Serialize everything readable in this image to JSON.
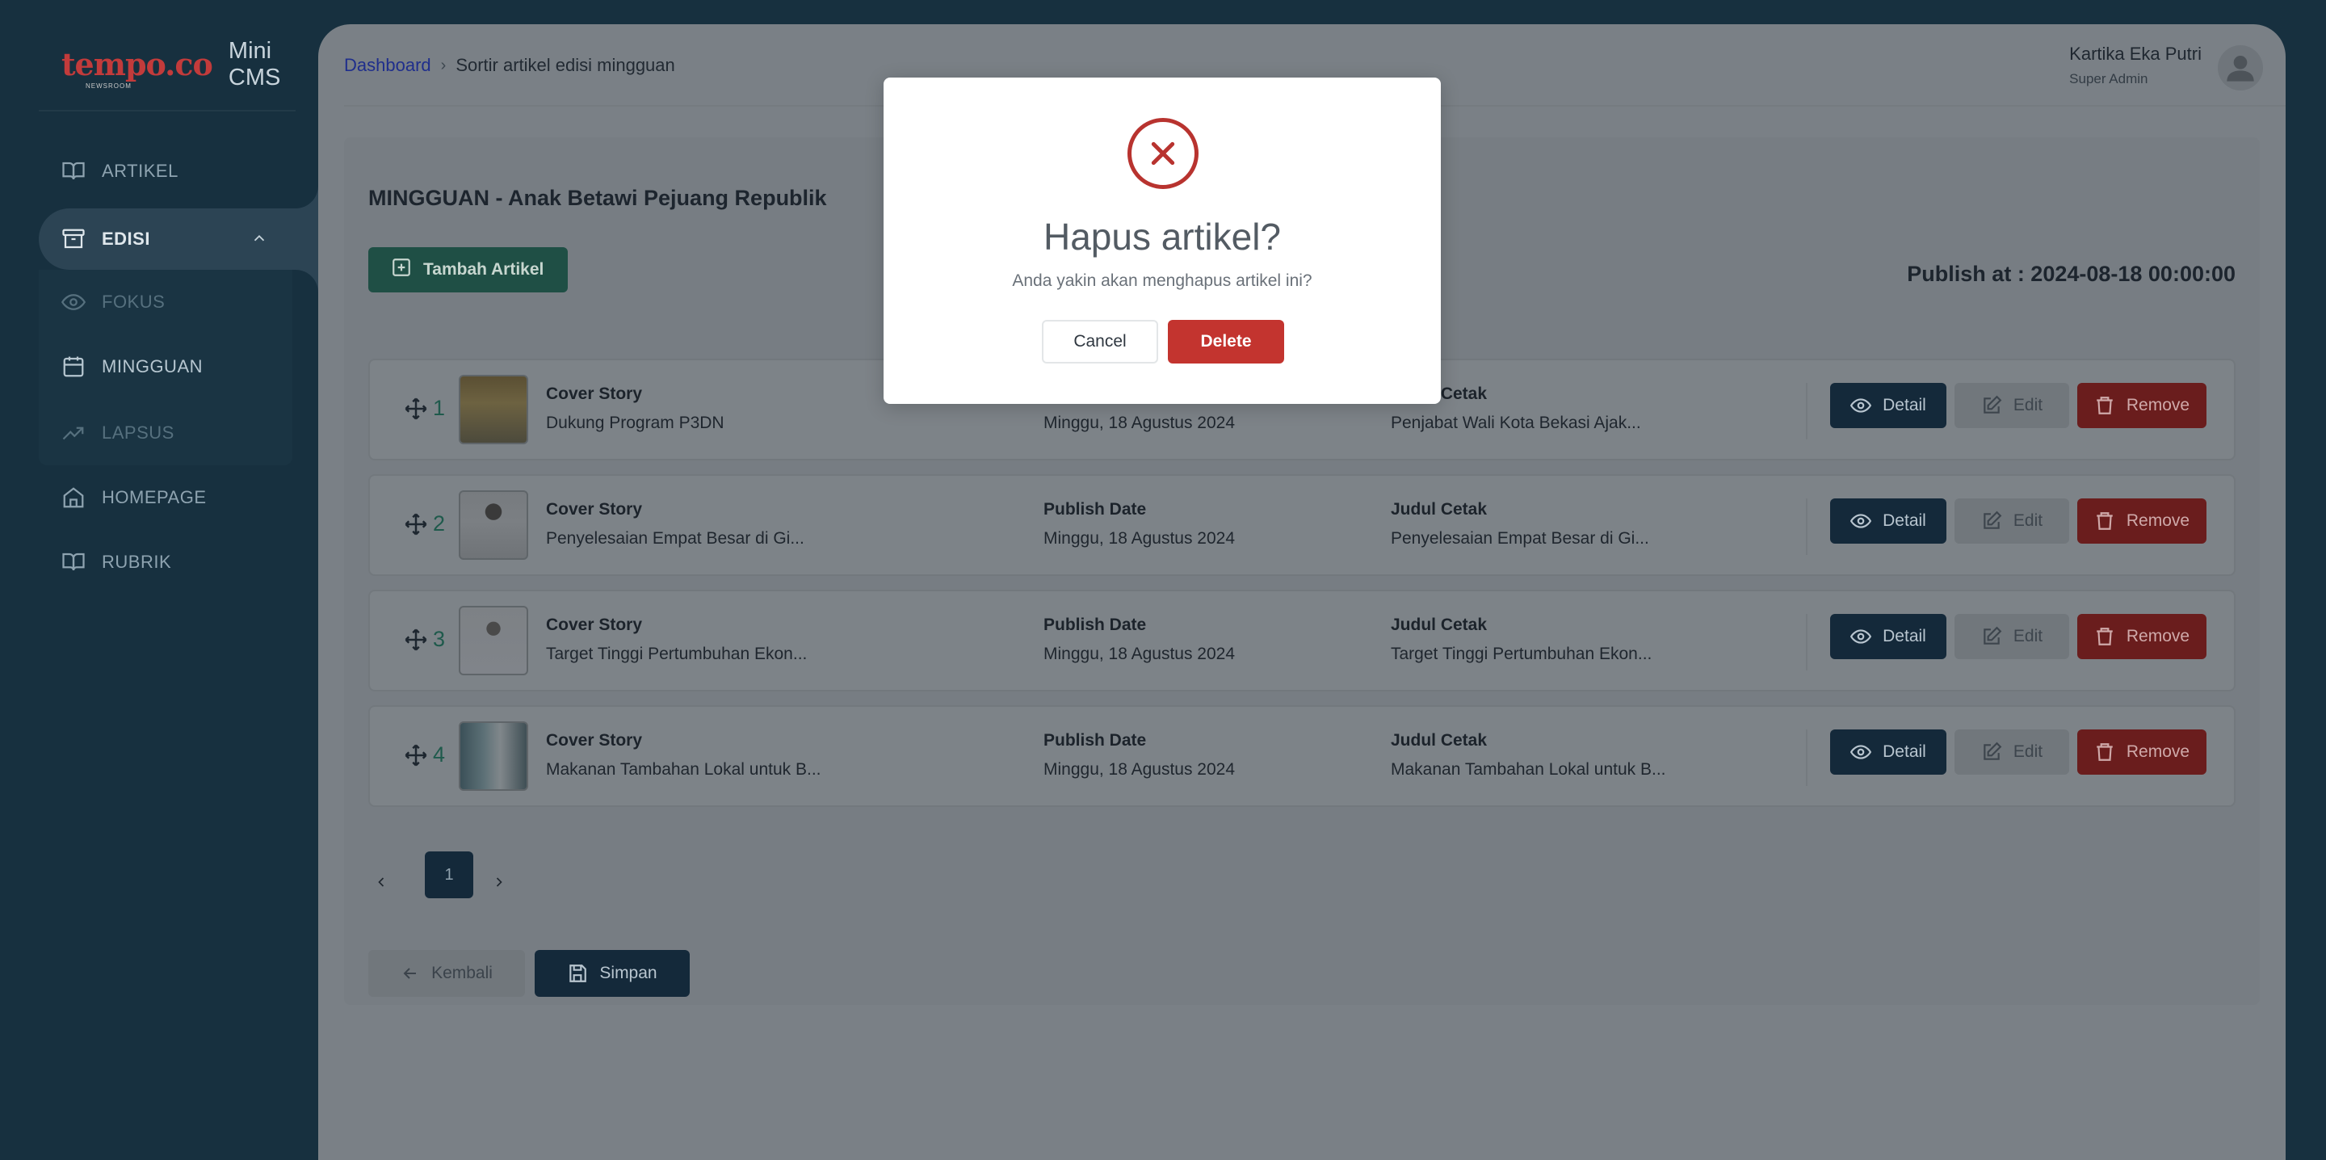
{
  "sidebar": {
    "logo_text": "tempo.co",
    "logo_sub": "NEWSROOM",
    "app_title": "Mini CMS",
    "items": [
      {
        "label": "ARTIKEL",
        "icon": "book-open-icon"
      },
      {
        "label": "EDISI",
        "icon": "archive-icon"
      },
      {
        "label": "FOKUS",
        "icon": "eye-icon"
      },
      {
        "label": "MINGGUAN",
        "icon": "calendar-icon"
      },
      {
        "label": "LAPSUS",
        "icon": "trending-up-icon"
      },
      {
        "label": "HOMEPAGE",
        "icon": "home-icon"
      },
      {
        "label": "RUBRIK",
        "icon": "book-open-icon"
      }
    ]
  },
  "header": {
    "breadcrumb_home": "Dashboard",
    "breadcrumb_current": "Sortir artikel edisi mingguan",
    "user_name": "Kartika Eka Putri",
    "user_role": "Super Admin"
  },
  "edition": {
    "title": "MINGGUAN - Anak Betawi Pejuang Republik",
    "add_button": "Tambah Artikel",
    "publish_at": "Publish at : 2024-08-18 00:00:00"
  },
  "columns": {
    "category_label": "Cover Story",
    "publish_label": "Publish Date",
    "print_label": "Judul Cetak"
  },
  "articles": [
    {
      "no": "1",
      "category": "Cover Story",
      "title": "Dukung Program P3DN",
      "publish_date": "Minggu, 18 Agustus 2024",
      "print_title": "Penjabat Wali Kota Bekasi Ajak..."
    },
    {
      "no": "2",
      "category": "Cover Story",
      "title": "Penyelesaian Empat Besar di Gi...",
      "publish_date": "Minggu, 18 Agustus 2024",
      "print_title": "Penyelesaian Empat Besar di Gi..."
    },
    {
      "no": "3",
      "category": "Cover Story",
      "title": "Target Tinggi Pertumbuhan Ekon...",
      "publish_date": "Minggu, 18 Agustus 2024",
      "print_title": "Target Tinggi Pertumbuhan Ekon..."
    },
    {
      "no": "4",
      "category": "Cover Story",
      "title": "Makanan Tambahan Lokal untuk B...",
      "publish_date": "Minggu, 18 Agustus 2024",
      "print_title": "Makanan Tambahan Lokal untuk B..."
    }
  ],
  "actions": {
    "detail": "Detail",
    "edit": "Edit",
    "remove": "Remove"
  },
  "pagination": {
    "current": "1"
  },
  "footer": {
    "back": "Kembali",
    "save": "Simpan"
  },
  "modal": {
    "title": "Hapus artikel?",
    "text": "Anda yakin akan menghapus artikel ini?",
    "cancel": "Cancel",
    "delete": "Delete"
  },
  "colors": {
    "accent": "#1f4f45",
    "danger": "#c3342f",
    "navy": "#14293a"
  }
}
